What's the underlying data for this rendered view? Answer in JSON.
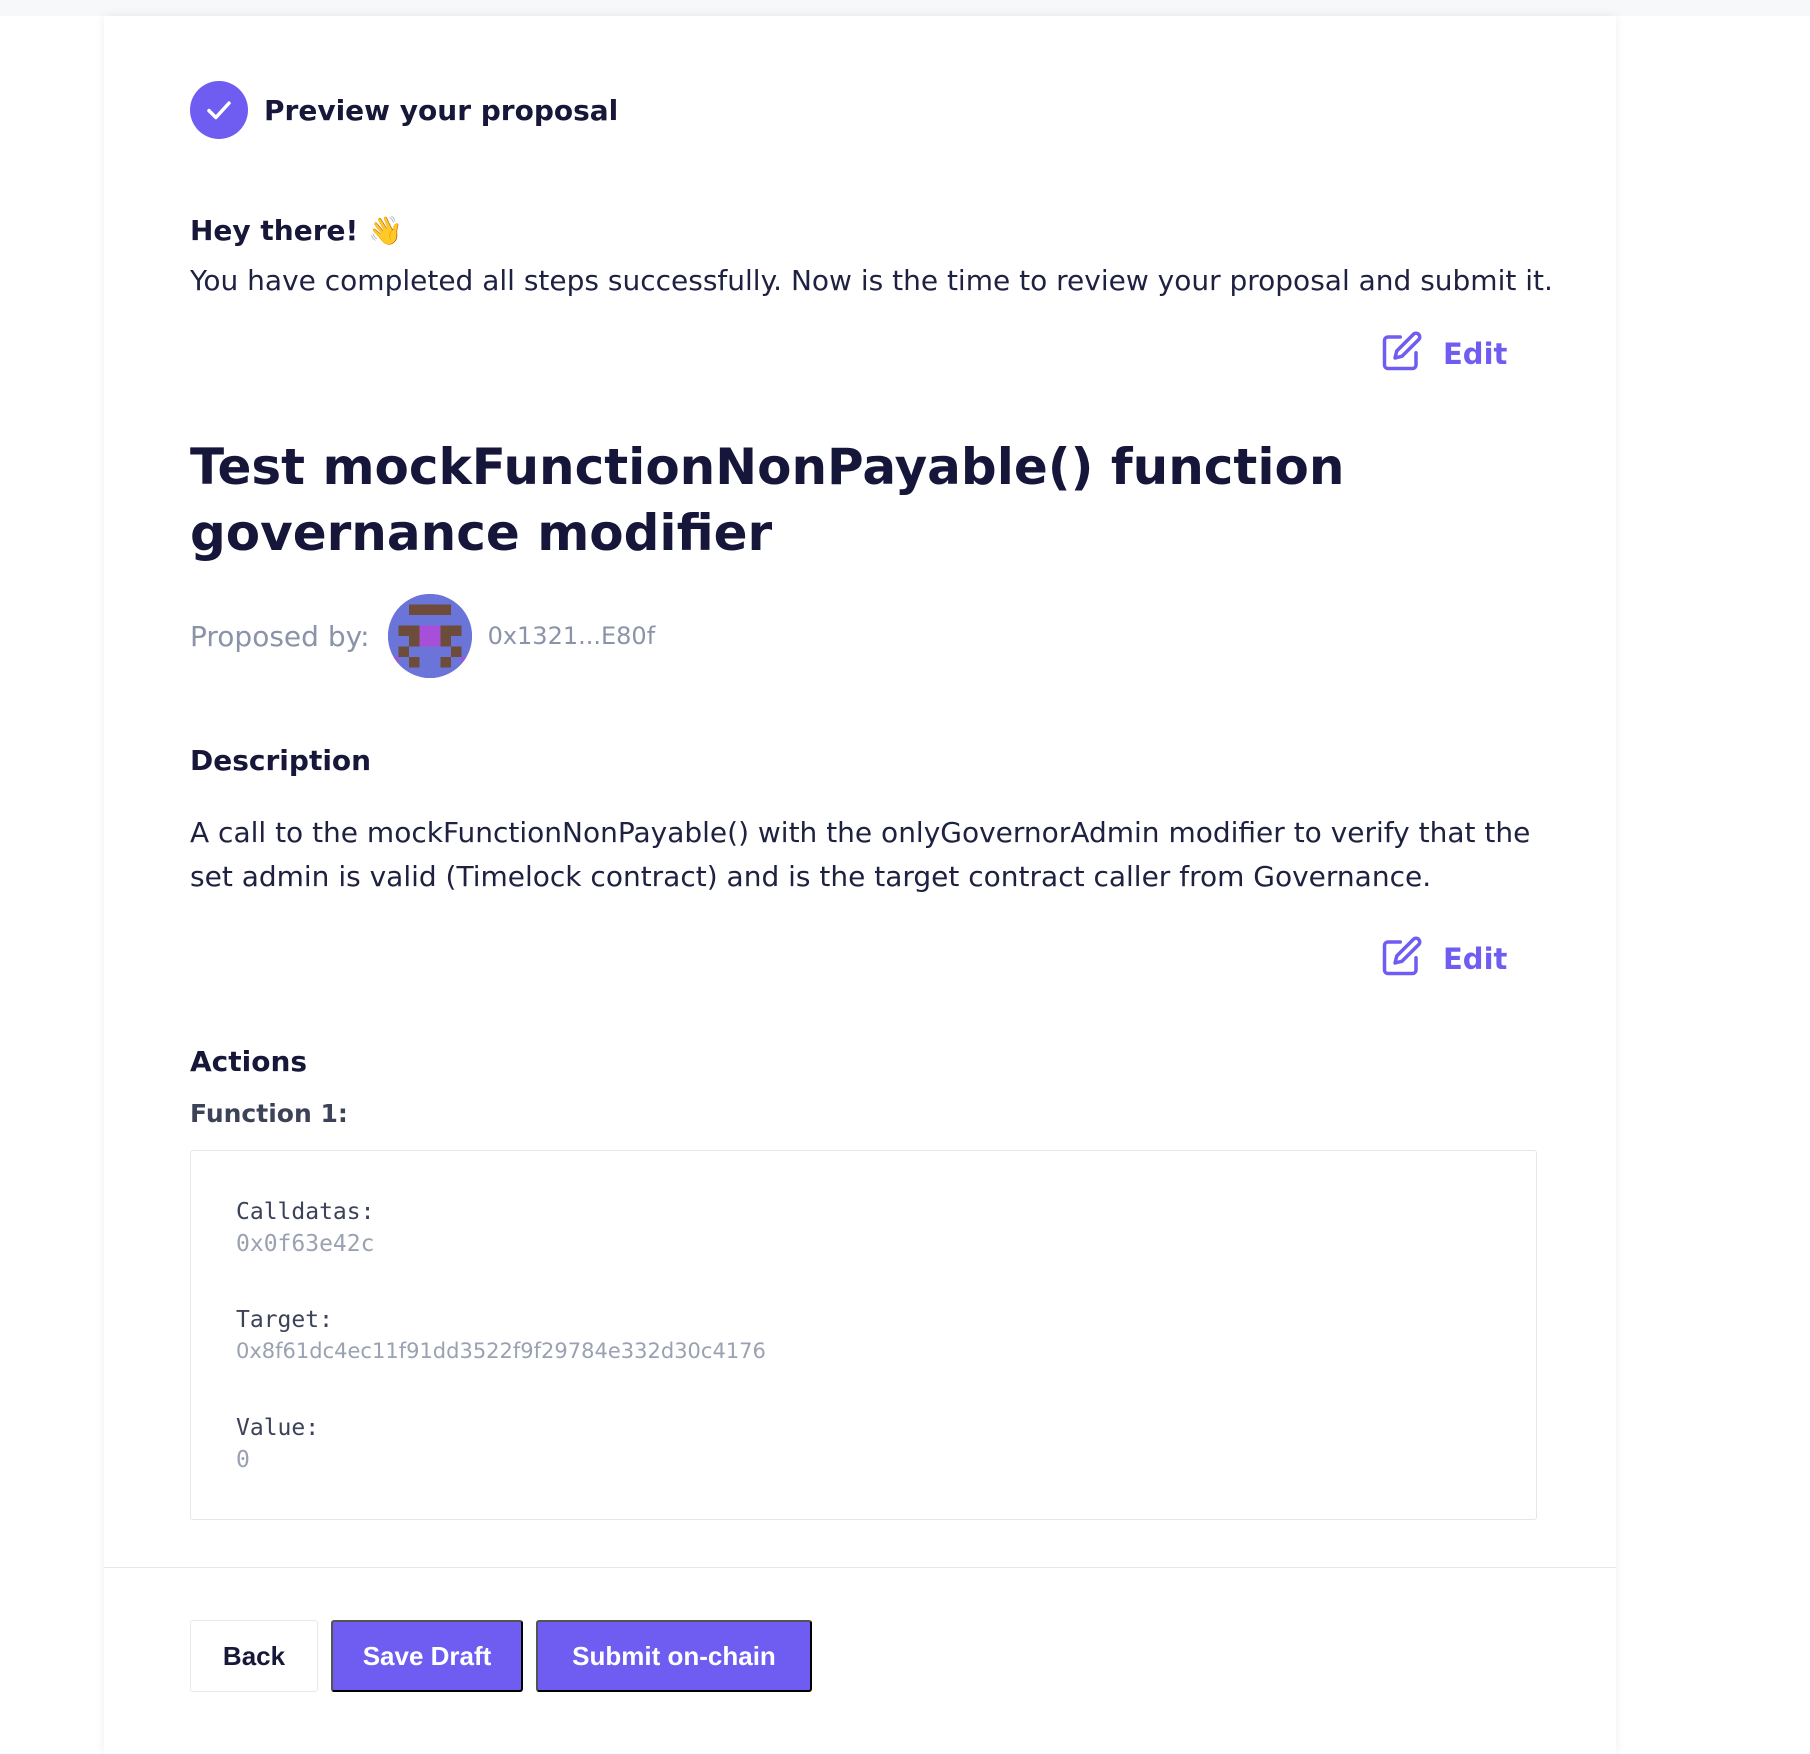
{
  "step": {
    "title": "Preview your proposal",
    "icon": "check-icon",
    "accent": "#6f5cf1"
  },
  "greeting": {
    "title": "Hey there! 👋",
    "text": "You have completed all steps successfully. Now is the time to review your proposal and submit it."
  },
  "edit_label": "Edit",
  "proposal": {
    "title": "Test mockFunctionNonPayable() function governance modifier",
    "proposed_by_label": "Proposed by:",
    "proposer_address": "0x1321...E80f"
  },
  "description": {
    "heading": "Description",
    "text": "A call to the mockFunctionNonPayable() with the onlyGovernorAdmin modifier to verify that the set admin is valid (Timelock contract) and is the target contract caller from Governance."
  },
  "actions": {
    "heading": "Actions",
    "functions": [
      {
        "label": "Function 1:",
        "calldatas_label": "Calldatas:",
        "calldatas": "0x0f63e42c",
        "target_label": "Target:",
        "target": "0x8f61dc4ec11f91dd3522f9f29784e332d30c4176",
        "value_label": "Value:",
        "value": "0"
      }
    ]
  },
  "buttons": {
    "back": "Back",
    "save_draft": "Save Draft",
    "submit": "Submit on-chain"
  }
}
